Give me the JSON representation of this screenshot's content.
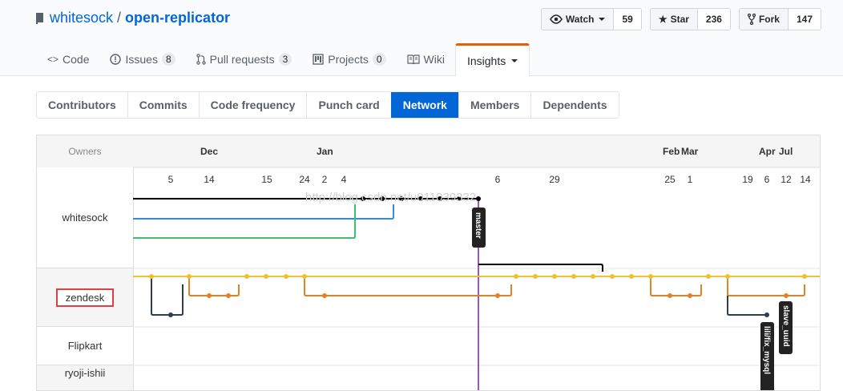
{
  "repo": {
    "owner": "whitesock",
    "separator": "/",
    "name": "open-replicator"
  },
  "actions": {
    "watch": {
      "label": "Watch",
      "count": "59"
    },
    "star": {
      "label": "Star",
      "count": "236"
    },
    "fork": {
      "label": "Fork",
      "count": "147"
    }
  },
  "reponav": [
    {
      "label": "Code",
      "counter": "",
      "icon": "code-icon"
    },
    {
      "label": "Issues",
      "counter": "8",
      "icon": "issue-icon"
    },
    {
      "label": "Pull requests",
      "counter": "3",
      "icon": "pull-request-icon"
    },
    {
      "label": "Projects",
      "counter": "0",
      "icon": "project-icon"
    },
    {
      "label": "Wiki",
      "counter": "",
      "icon": "book-icon"
    },
    {
      "label": "Insights",
      "counter": "",
      "icon": ""
    }
  ],
  "subnav": [
    "Contributors",
    "Commits",
    "Code frequency",
    "Punch card",
    "Network",
    "Members",
    "Dependents"
  ],
  "network": {
    "owners_header": "Owners",
    "owners": [
      "whitesock",
      "zendesk",
      "Flipkart",
      "ryoji-ishii"
    ],
    "months": [
      "Dec",
      "Jan",
      "Feb",
      "Mar",
      "Apr",
      "Jul"
    ],
    "days": [
      "5",
      "14",
      "15",
      "24",
      "2",
      "4",
      "6",
      "29",
      "25",
      "1",
      "19",
      "6",
      "12",
      "14"
    ],
    "branch_labels": [
      "master",
      "lili/fix_mysql",
      "slave_uuid"
    ],
    "watermark": "http://blog.csdn.net/u011039332"
  },
  "colors": {
    "accent": "#0366d6",
    "nav_active": "#e36209",
    "black": "#000000",
    "blue": "#2e8fd8",
    "green": "#3ebe6e",
    "yellow": "#f0c030",
    "orange": "#e0822a",
    "purple": "#9b59b6",
    "navy": "#2c3e50"
  }
}
